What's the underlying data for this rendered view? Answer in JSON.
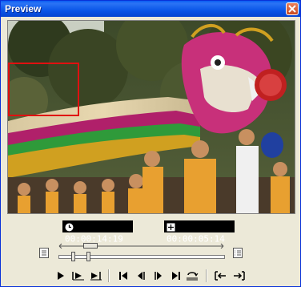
{
  "window": {
    "title": "Preview"
  },
  "timecodes": {
    "current": "00:00:14:19",
    "duration": "00:00:05:14"
  },
  "playback": {
    "position": 0.15,
    "mark_in": 0.08,
    "mark_out": 0.17
  },
  "icons": {
    "close": "close-icon",
    "clock": "clock-icon",
    "duration": "duration-icon",
    "toggle_left": "list-icon",
    "toggle_right": "list-details-icon",
    "play": "play-icon",
    "play_from_mark": "play-from-mark-icon",
    "play_to_mark": "play-to-mark-icon",
    "go_start": "go-to-start-icon",
    "prev_frame": "previous-frame-icon",
    "next_frame": "next-frame-icon",
    "go_end": "go-to-end-icon",
    "loop": "loop-icon",
    "mark_in": "mark-in-icon",
    "mark_out": "mark-out-icon"
  },
  "colors": {
    "titlebar": "#0a56e8",
    "selection_box": "#e01010",
    "timecode_bg": "#000000"
  }
}
